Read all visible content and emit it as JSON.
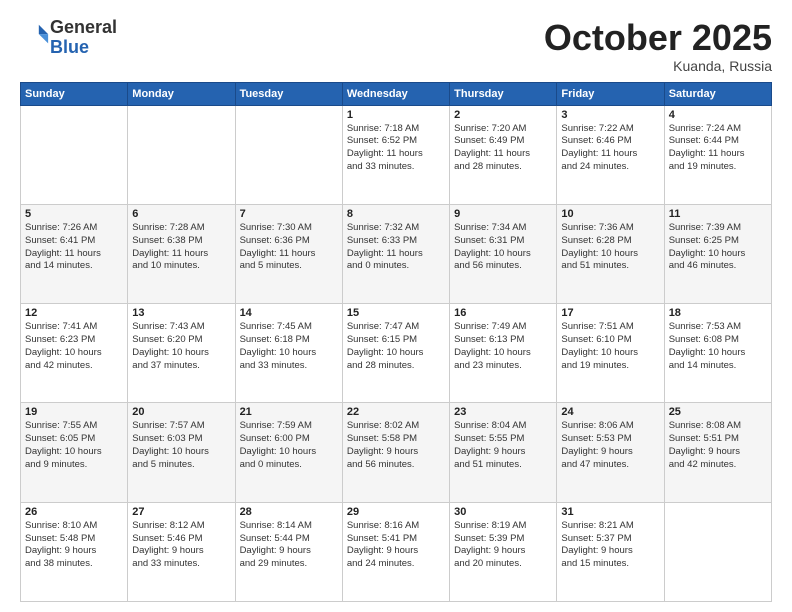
{
  "header": {
    "logo_general": "General",
    "logo_blue": "Blue",
    "month": "October 2025",
    "location": "Kuanda, Russia"
  },
  "weekdays": [
    "Sunday",
    "Monday",
    "Tuesday",
    "Wednesday",
    "Thursday",
    "Friday",
    "Saturday"
  ],
  "weeks": [
    [
      {
        "day": "",
        "info": ""
      },
      {
        "day": "",
        "info": ""
      },
      {
        "day": "",
        "info": ""
      },
      {
        "day": "1",
        "info": "Sunrise: 7:18 AM\nSunset: 6:52 PM\nDaylight: 11 hours\nand 33 minutes."
      },
      {
        "day": "2",
        "info": "Sunrise: 7:20 AM\nSunset: 6:49 PM\nDaylight: 11 hours\nand 28 minutes."
      },
      {
        "day": "3",
        "info": "Sunrise: 7:22 AM\nSunset: 6:46 PM\nDaylight: 11 hours\nand 24 minutes."
      },
      {
        "day": "4",
        "info": "Sunrise: 7:24 AM\nSunset: 6:44 PM\nDaylight: 11 hours\nand 19 minutes."
      }
    ],
    [
      {
        "day": "5",
        "info": "Sunrise: 7:26 AM\nSunset: 6:41 PM\nDaylight: 11 hours\nand 14 minutes."
      },
      {
        "day": "6",
        "info": "Sunrise: 7:28 AM\nSunset: 6:38 PM\nDaylight: 11 hours\nand 10 minutes."
      },
      {
        "day": "7",
        "info": "Sunrise: 7:30 AM\nSunset: 6:36 PM\nDaylight: 11 hours\nand 5 minutes."
      },
      {
        "day": "8",
        "info": "Sunrise: 7:32 AM\nSunset: 6:33 PM\nDaylight: 11 hours\nand 0 minutes."
      },
      {
        "day": "9",
        "info": "Sunrise: 7:34 AM\nSunset: 6:31 PM\nDaylight: 10 hours\nand 56 minutes."
      },
      {
        "day": "10",
        "info": "Sunrise: 7:36 AM\nSunset: 6:28 PM\nDaylight: 10 hours\nand 51 minutes."
      },
      {
        "day": "11",
        "info": "Sunrise: 7:39 AM\nSunset: 6:25 PM\nDaylight: 10 hours\nand 46 minutes."
      }
    ],
    [
      {
        "day": "12",
        "info": "Sunrise: 7:41 AM\nSunset: 6:23 PM\nDaylight: 10 hours\nand 42 minutes."
      },
      {
        "day": "13",
        "info": "Sunrise: 7:43 AM\nSunset: 6:20 PM\nDaylight: 10 hours\nand 37 minutes."
      },
      {
        "day": "14",
        "info": "Sunrise: 7:45 AM\nSunset: 6:18 PM\nDaylight: 10 hours\nand 33 minutes."
      },
      {
        "day": "15",
        "info": "Sunrise: 7:47 AM\nSunset: 6:15 PM\nDaylight: 10 hours\nand 28 minutes."
      },
      {
        "day": "16",
        "info": "Sunrise: 7:49 AM\nSunset: 6:13 PM\nDaylight: 10 hours\nand 23 minutes."
      },
      {
        "day": "17",
        "info": "Sunrise: 7:51 AM\nSunset: 6:10 PM\nDaylight: 10 hours\nand 19 minutes."
      },
      {
        "day": "18",
        "info": "Sunrise: 7:53 AM\nSunset: 6:08 PM\nDaylight: 10 hours\nand 14 minutes."
      }
    ],
    [
      {
        "day": "19",
        "info": "Sunrise: 7:55 AM\nSunset: 6:05 PM\nDaylight: 10 hours\nand 9 minutes."
      },
      {
        "day": "20",
        "info": "Sunrise: 7:57 AM\nSunset: 6:03 PM\nDaylight: 10 hours\nand 5 minutes."
      },
      {
        "day": "21",
        "info": "Sunrise: 7:59 AM\nSunset: 6:00 PM\nDaylight: 10 hours\nand 0 minutes."
      },
      {
        "day": "22",
        "info": "Sunrise: 8:02 AM\nSunset: 5:58 PM\nDaylight: 9 hours\nand 56 minutes."
      },
      {
        "day": "23",
        "info": "Sunrise: 8:04 AM\nSunset: 5:55 PM\nDaylight: 9 hours\nand 51 minutes."
      },
      {
        "day": "24",
        "info": "Sunrise: 8:06 AM\nSunset: 5:53 PM\nDaylight: 9 hours\nand 47 minutes."
      },
      {
        "day": "25",
        "info": "Sunrise: 8:08 AM\nSunset: 5:51 PM\nDaylight: 9 hours\nand 42 minutes."
      }
    ],
    [
      {
        "day": "26",
        "info": "Sunrise: 8:10 AM\nSunset: 5:48 PM\nDaylight: 9 hours\nand 38 minutes."
      },
      {
        "day": "27",
        "info": "Sunrise: 8:12 AM\nSunset: 5:46 PM\nDaylight: 9 hours\nand 33 minutes."
      },
      {
        "day": "28",
        "info": "Sunrise: 8:14 AM\nSunset: 5:44 PM\nDaylight: 9 hours\nand 29 minutes."
      },
      {
        "day": "29",
        "info": "Sunrise: 8:16 AM\nSunset: 5:41 PM\nDaylight: 9 hours\nand 24 minutes."
      },
      {
        "day": "30",
        "info": "Sunrise: 8:19 AM\nSunset: 5:39 PM\nDaylight: 9 hours\nand 20 minutes."
      },
      {
        "day": "31",
        "info": "Sunrise: 8:21 AM\nSunset: 5:37 PM\nDaylight: 9 hours\nand 15 minutes."
      },
      {
        "day": "",
        "info": ""
      }
    ]
  ]
}
